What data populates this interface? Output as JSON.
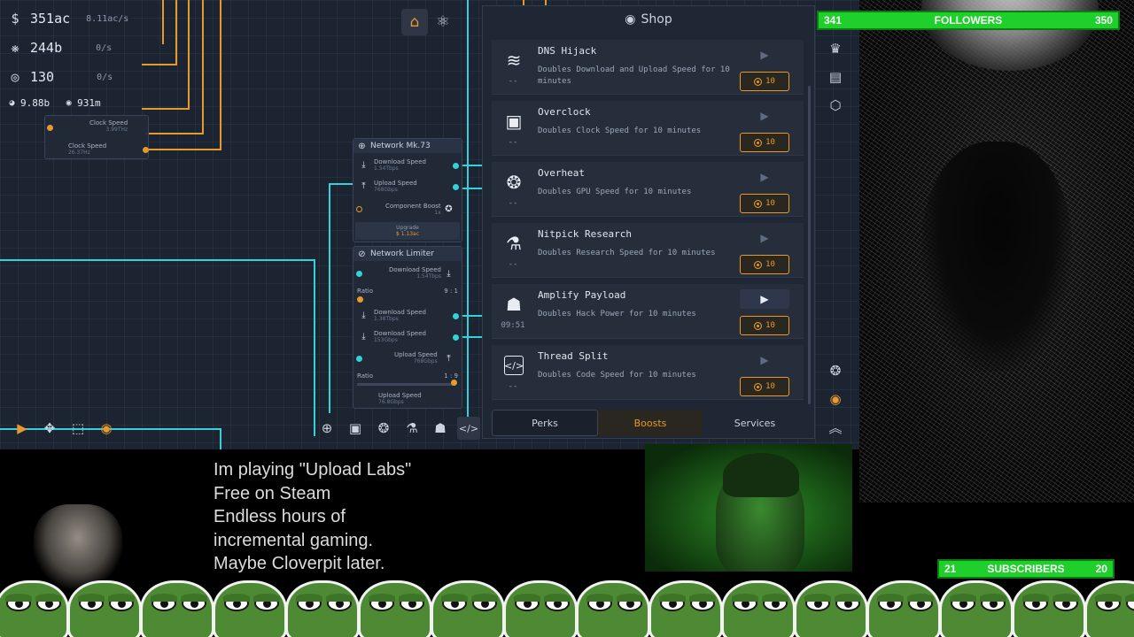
{
  "resources": [
    {
      "icon": "dollar-icon",
      "value": "351ac",
      "rate": "8.11ac/s"
    },
    {
      "icon": "cpu-icon",
      "value": "244b",
      "rate": "0/s"
    },
    {
      "icon": "research-icon",
      "value": "130",
      "rate": "0/s"
    }
  ],
  "mini_stats": [
    {
      "icon": "hack-icon",
      "value": "9.88b"
    },
    {
      "icon": "target-icon",
      "value": "931m"
    }
  ],
  "left_node": {
    "rows": [
      {
        "label": "Clock Speed",
        "sub": "3.99THz"
      },
      {
        "label": "Clock Speed",
        "sub": "26.37Hz"
      }
    ]
  },
  "network_node": {
    "title": "Network Mk.73",
    "download_label": "Download Speed",
    "download_sub": "1.54Tbps",
    "upload_label": "Upload Speed",
    "upload_sub": "768Gbps",
    "boost_label": "Component Boost",
    "boost_sub": "1x",
    "upgrade_label": "Upgrade",
    "upgrade_cost": "1.13ac"
  },
  "limiter_node": {
    "title": "Network Limiter",
    "download_label": "Download Speed",
    "download_sub": "1.54Tbps",
    "ratio_label": "Ratio",
    "ratio_value": "9 : 1",
    "dl2_label": "Download Speed",
    "dl2_sub": "1.38Tbps",
    "dl3_label": "Download Speed",
    "dl3_sub": "153Gbps",
    "ul_label": "Upload Speed",
    "ul_sub": "768Gbps",
    "ratio2_label": "Ratio",
    "ratio2_value": "1 : 9",
    "ul2_label": "Upload Speed",
    "ul2_sub": "76.8Gbps"
  },
  "shop": {
    "title": "Shop",
    "items": [
      {
        "icon": "wifi-icon",
        "name": "DNS Hijack",
        "desc": "Doubles Download and Upload Speed for 10 minutes",
        "timer": "--",
        "price": "10",
        "active": false
      },
      {
        "icon": "cpu-chip-icon",
        "name": "Overclock",
        "desc": "Doubles Clock Speed for 10 minutes",
        "timer": "--",
        "price": "10",
        "active": false
      },
      {
        "icon": "fan-icon",
        "name": "Overheat",
        "desc": "Doubles GPU Speed for 10 minutes",
        "timer": "--",
        "price": "10",
        "active": false
      },
      {
        "icon": "microscope-icon",
        "name": "Nitpick Research",
        "desc": "Doubles Research Speed for 10 minutes",
        "timer": "--",
        "price": "10",
        "active": false
      },
      {
        "icon": "hacker-icon",
        "name": "Amplify Payload",
        "desc": "Doubles Hack Power for 10 minutes",
        "timer": "09:51",
        "price": "10",
        "active": true
      },
      {
        "icon": "code-icon",
        "name": "Thread Split",
        "desc": "Doubles Code Speed for 10 minutes",
        "timer": "--",
        "price": "10",
        "active": false
      }
    ],
    "tabs": [
      "Perks",
      "Boosts",
      "Services"
    ]
  },
  "stream": {
    "followers_current": "341",
    "followers_label": "FOLLOWERS",
    "followers_goal": "350",
    "subscribers_current": "21",
    "subscribers_label": "SUBSCRIBERS",
    "subscribers_goal": "20",
    "caption": [
      "Im playing \"Upload Labs\"",
      "Free on Steam",
      "Endless hours of",
      "incremental gaming.",
      "Maybe Cloverpit later."
    ]
  },
  "colors": {
    "accent": "#e59a2b",
    "wire_cyan": "#34d2d8",
    "goal_green": "#1fcf2c"
  }
}
